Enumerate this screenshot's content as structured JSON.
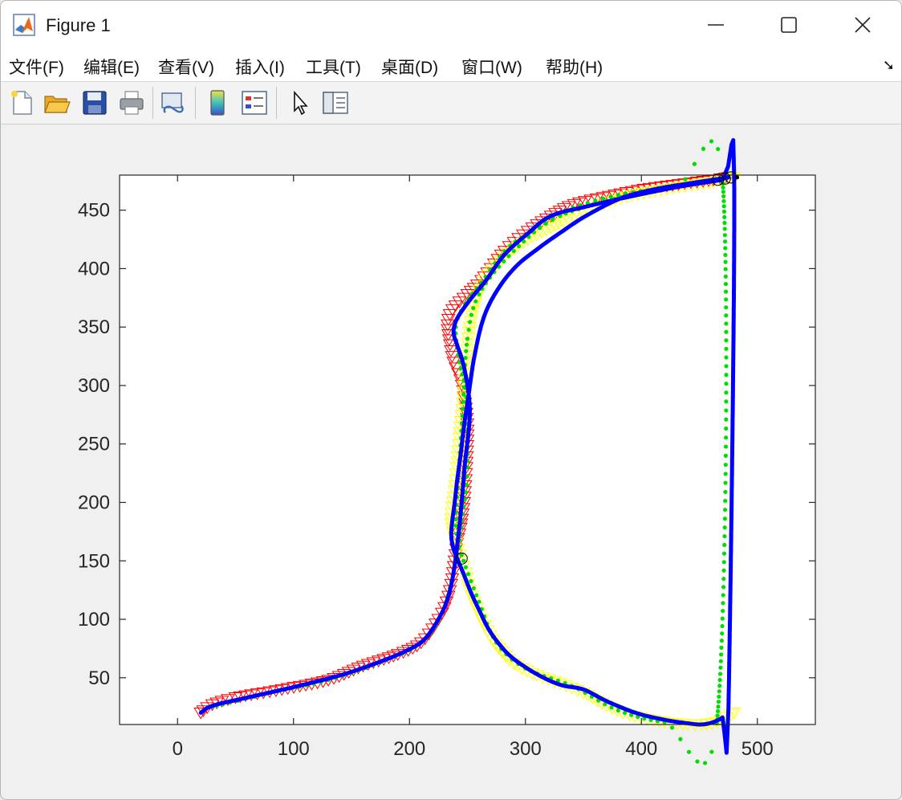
{
  "window": {
    "title": "Figure 1"
  },
  "menu": {
    "items": [
      "文件(F)",
      "编辑(E)",
      "查看(V)",
      "插入(I)",
      "工具(T)",
      "桌面(D)",
      "窗口(W)",
      "帮助(H)"
    ],
    "overflow_icon": "dock-arrow-icon"
  },
  "toolbar": {
    "tools": [
      "new-figure-icon",
      "open-file-icon",
      "save-icon",
      "print-icon",
      "link-plot-icon",
      "colorbar-icon",
      "legend-icon",
      "pointer-icon",
      "property-inspector-icon"
    ]
  },
  "chart_data": {
    "type": "line",
    "title": "",
    "xlabel": "",
    "ylabel": "",
    "xlim": [
      -50,
      550
    ],
    "ylim": [
      10,
      480
    ],
    "xticks": [
      0,
      100,
      200,
      300,
      400,
      500
    ],
    "yticks": [
      50,
      100,
      150,
      200,
      250,
      300,
      350,
      400,
      450
    ],
    "grid": false,
    "series": [
      {
        "marker": "triangle-down",
        "color": "#ff0000",
        "x": [
          20,
          30,
          50,
          90,
          130,
          160,
          190,
          210,
          225,
          232,
          236,
          239,
          241,
          244,
          247,
          249,
          250,
          248,
          244,
          238,
          235,
          233,
          237,
          250,
          262,
          282,
          302,
          322,
          342,
          372,
          402,
          432,
          462,
          475
        ],
        "y": [
          20,
          27,
          33,
          40,
          48,
          60,
          70,
          80,
          100,
          115,
          130,
          150,
          165,
          178,
          200,
          230,
          262,
          285,
          305,
          320,
          335,
          352,
          365,
          378,
          390,
          415,
          432,
          445,
          455,
          462,
          468,
          472,
          476,
          478
        ]
      },
      {
        "marker": "triangle-down",
        "color": "#ffff00",
        "x": [
          480,
          465,
          452,
          440,
          420,
          390,
          370,
          350,
          330,
          310,
          290,
          280,
          272,
          265,
          258,
          252,
          248,
          245,
          242,
          239,
          237,
          236,
          237,
          239,
          241,
          243,
          246,
          249,
          252,
          257,
          265,
          282,
          302,
          322,
          342,
          382,
          422,
          462,
          480
        ],
        "y": [
          20,
          12,
          10,
          10,
          12,
          18,
          26,
          37,
          45,
          52,
          62,
          72,
          82,
          95,
          110,
          125,
          140,
          150,
          160,
          170,
          178,
          186,
          196,
          210,
          230,
          255,
          285,
          320,
          350,
          372,
          390,
          410,
          425,
          435,
          445,
          460,
          468,
          474,
          478
        ]
      },
      {
        "marker": "point",
        "color": "#00dd00",
        "x": [
          30,
          80,
          130,
          180,
          210,
          228,
          240,
          246,
          250,
          249,
          243,
          240,
          248,
          262,
          282,
          302,
          330,
          380,
          430,
          470,
          465,
          420,
          380,
          340,
          300,
          275,
          260,
          245,
          240,
          242,
          246,
          250,
          260,
          290,
          330,
          400,
          455
        ],
        "y": [
          25,
          37,
          48,
          65,
          80,
          105,
          150,
          190,
          230,
          290,
          320,
          350,
          370,
          388,
          415,
          430,
          448,
          463,
          470,
          476,
          11,
          12,
          22,
          43,
          58,
          80,
          115,
          155,
          180,
          220,
          280,
          340,
          378,
          415,
          445,
          465,
          474
        ]
      },
      {
        "marker": "line",
        "color": "#0000ff",
        "x": [
          20,
          30,
          60,
          100,
          140,
          170,
          195,
          212,
          225,
          233,
          238,
          242,
          245,
          248,
          251,
          252,
          250,
          246,
          241,
          238,
          240,
          246,
          256,
          266,
          282,
          302,
          322,
          352,
          392,
          432,
          470,
          480,
          475,
          470,
          462,
          452,
          440,
          420,
          395,
          370,
          350,
          330,
          310,
          290,
          278,
          268,
          260,
          253,
          247,
          242,
          238,
          236,
          237,
          239,
          241,
          244,
          247,
          251,
          256,
          264,
          276,
          292,
          312,
          332,
          352,
          382,
          412,
          442,
          475
        ],
        "y": [
          20,
          26,
          33,
          42,
          52,
          62,
          72,
          82,
          100,
          118,
          140,
          170,
          200,
          235,
          260,
          280,
          300,
          320,
          335,
          345,
          355,
          365,
          378,
          390,
          412,
          430,
          445,
          453,
          462,
          470,
          476,
          478,
          21,
          16,
          12,
          10,
          11,
          14,
          20,
          30,
          40,
          44,
          53,
          66,
          78,
          92,
          108,
          123,
          138,
          150,
          160,
          172,
          185,
          200,
          218,
          240,
          265,
          292,
          325,
          358,
          382,
          402,
          418,
          432,
          445,
          460,
          468,
          473,
          478
        ]
      },
      {
        "marker": "circle",
        "color": "#000000",
        "x": [
          245,
          466,
          472,
          477
        ],
        "y": [
          152,
          476,
          477,
          478
        ]
      }
    ]
  }
}
